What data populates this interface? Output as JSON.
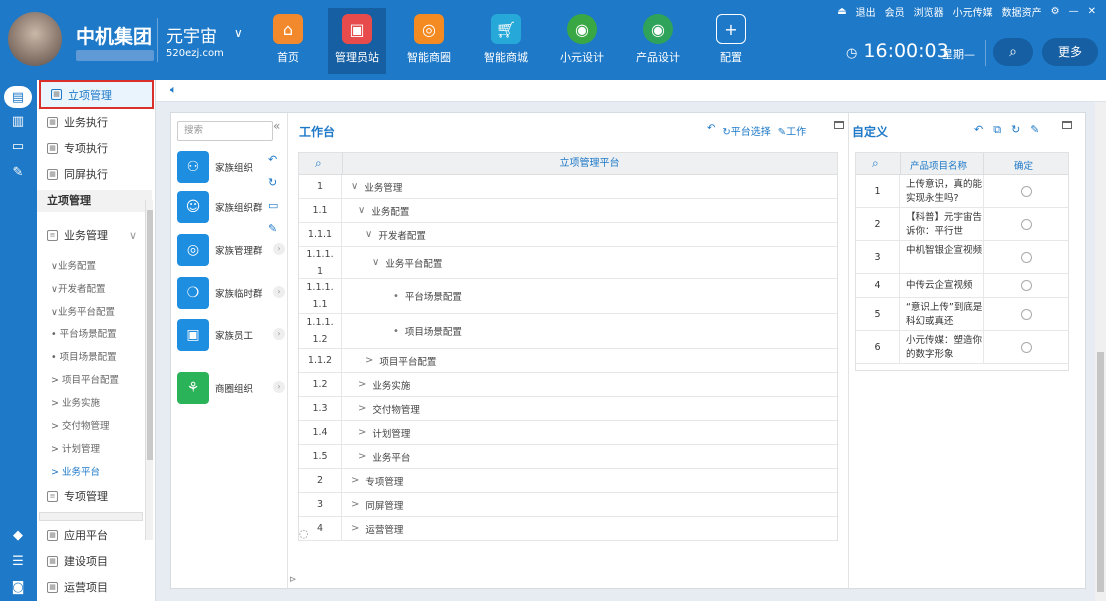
{
  "header": {
    "brand": "中机集团",
    "universe": "元宇宙",
    "universe_url": "520ezj.com",
    "nav": [
      {
        "label": "首页",
        "icon": "home-icon",
        "color": "#f2892c"
      },
      {
        "label": "管理员站",
        "icon": "monitor-icon",
        "color": "#e84b4b"
      },
      {
        "label": "智能商圈",
        "icon": "ring-icon",
        "color": "#f48a22"
      },
      {
        "label": "智能商城",
        "icon": "cart-icon",
        "color": "#26a8d8"
      },
      {
        "label": "小元设计",
        "icon": "design-globe-icon",
        "color": "#39a844"
      },
      {
        "label": "产品设计",
        "icon": "product-globe-icon",
        "color": "#2fa35a"
      },
      {
        "label": "配置",
        "icon": "plus-icon",
        "color": "#1e79c8"
      }
    ],
    "top_links": [
      "退出",
      "会员",
      "浏览器",
      "小元传媒",
      "数据资产"
    ],
    "time": "16:00:03",
    "weekday": "星期—",
    "more": "更多"
  },
  "sidebar": {
    "top_items": [
      "立项管理",
      "业务执行",
      "专项执行",
      "同屏执行"
    ],
    "section_title": "立项管理",
    "tree_root": "业务管理",
    "tree": [
      {
        "label": "∨业务配置",
        "active": false
      },
      {
        "label": "∨开发者配置",
        "active": false
      },
      {
        "label": "∨业务平台配置",
        "active": false
      },
      {
        "label": "• 平台场景配置",
        "active": false
      },
      {
        "label": "• 项目场景配置",
        "active": false
      },
      {
        "label": "> 项目平台配置",
        "active": false
      },
      {
        "label": "> 业务实施",
        "active": false
      },
      {
        "label": "> 交付物管理",
        "active": false
      },
      {
        "label": "> 计划管理",
        "active": false
      },
      {
        "label": "> 业务平台",
        "active": true
      }
    ],
    "tree_root2": "专项管理",
    "bottom_items": [
      "应用平台",
      "建设项目",
      "运营项目"
    ]
  },
  "groups": {
    "search_placeholder": "搜索",
    "items": [
      {
        "label": "家族组织",
        "icon": "org-icon"
      },
      {
        "label": "家族组织群",
        "icon": "user-icon"
      },
      {
        "label": "家族管理群",
        "icon": "target-icon"
      },
      {
        "label": "家族临时群",
        "icon": "ring-icon"
      },
      {
        "label": "家族员工",
        "icon": "badge-icon"
      },
      {
        "label": "商圈组织",
        "icon": "tree-icon"
      }
    ]
  },
  "workbench": {
    "title": "工作台",
    "tools": [
      "平台选择",
      "工作"
    ],
    "table_title": "立项管理平台",
    "rows": [
      {
        "num": "1",
        "label": "业务管理",
        "mark": "∨",
        "level": 0
      },
      {
        "num": "1.1",
        "label": "业务配置",
        "mark": "∨",
        "level": 1
      },
      {
        "num": "1.1.1",
        "label": "开发者配置",
        "mark": "∨",
        "level": 2
      },
      {
        "num": "1.1.1.\n1",
        "label": "业务平台配置",
        "mark": "∨",
        "level": 3
      },
      {
        "num": "1.1.1.\n1.1",
        "label": "平台场景配置",
        "mark": "•",
        "level": 4
      },
      {
        "num": "1.1.1.\n1.2",
        "label": "项目场景配置",
        "mark": "•",
        "level": 4
      },
      {
        "num": "1.1.2",
        "label": "项目平台配置",
        "mark": ">",
        "level": 2
      },
      {
        "num": "1.2",
        "label": "业务实施",
        "mark": ">",
        "level": 1
      },
      {
        "num": "1.3",
        "label": "交付物管理",
        "mark": ">",
        "level": 1
      },
      {
        "num": "1.4",
        "label": "计划管理",
        "mark": ">",
        "level": 1
      },
      {
        "num": "1.5",
        "label": "业务平台",
        "mark": ">",
        "level": 1
      },
      {
        "num": "2",
        "label": "专项管理",
        "mark": ">",
        "level": 0
      },
      {
        "num": "3",
        "label": "同屏管理",
        "mark": ">",
        "level": 0
      },
      {
        "num": "4",
        "label": "运营管理",
        "mark": ">",
        "level": 0
      }
    ]
  },
  "custom": {
    "title": "自定义",
    "col_name": "产品项目名称",
    "col_confirm": "确定",
    "rows": [
      {
        "num": "1",
        "name": "上传意识，真的能实现永生吗?"
      },
      {
        "num": "2",
        "name": "【科普】元宇宙告诉你：平行世"
      },
      {
        "num": "3",
        "name": "中机智银企宣视频"
      },
      {
        "num": "4",
        "name": "中传云企宣视频"
      },
      {
        "num": "5",
        "name": "“意识上传”到底是科幻或真还"
      },
      {
        "num": "6",
        "name": "小元传媒：塑造你的数字形象"
      }
    ]
  }
}
